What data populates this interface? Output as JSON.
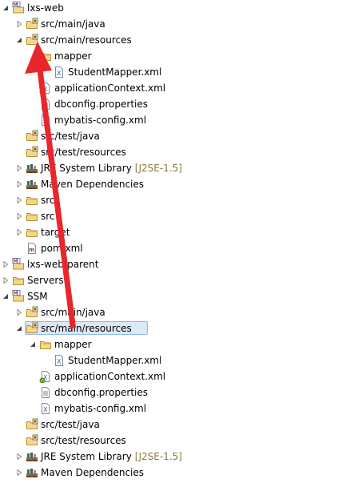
{
  "tree": [
    {
      "label": "lxs-web",
      "level": 0,
      "twisty": "expanded",
      "icon": "maven-project-icon"
    },
    {
      "label": "src/main/java",
      "level": 1,
      "twisty": "collapsed",
      "icon": "source-folder-icon"
    },
    {
      "label": "src/main/resources",
      "level": 1,
      "twisty": "expanded",
      "icon": "source-folder-icon"
    },
    {
      "label": "mapper",
      "level": 2,
      "twisty": "expanded",
      "icon": "folder-icon"
    },
    {
      "label": "StudentMapper.xml",
      "level": 3,
      "twisty": "none",
      "icon": "xml-file-icon"
    },
    {
      "label": "applicationContext.xml",
      "level": 2,
      "twisty": "none",
      "icon": "spring-xml-icon"
    },
    {
      "label": "dbconfig.properties",
      "level": 2,
      "twisty": "none",
      "icon": "properties-file-icon"
    },
    {
      "label": "mybatis-config.xml",
      "level": 2,
      "twisty": "none",
      "icon": "xml-file-icon"
    },
    {
      "label": "src/test/java",
      "level": 1,
      "twisty": "none",
      "icon": "source-folder-icon"
    },
    {
      "label": "src/test/resources",
      "level": 1,
      "twisty": "none",
      "icon": "source-folder-icon"
    },
    {
      "label": "JRE System Library",
      "decoration": "[J2SE-1.5]",
      "level": 1,
      "twisty": "collapsed",
      "icon": "library-icon"
    },
    {
      "label": "Maven Dependencies",
      "level": 1,
      "twisty": "collapsed",
      "icon": "library-icon"
    },
    {
      "label": "src",
      "level": 1,
      "twisty": "collapsed",
      "icon": "folder-icon"
    },
    {
      "label": "src",
      "level": 1,
      "twisty": "collapsed",
      "icon": "folder-icon"
    },
    {
      "label": "target",
      "level": 1,
      "twisty": "collapsed",
      "icon": "folder-icon"
    },
    {
      "label": "pom.xml",
      "level": 1,
      "twisty": "none",
      "icon": "maven-pom-icon"
    },
    {
      "label": "lxs-web-parent",
      "level": 0,
      "twisty": "collapsed",
      "icon": "maven-project-icon"
    },
    {
      "label": "Servers",
      "level": 0,
      "twisty": "collapsed",
      "icon": "folder-icon"
    },
    {
      "label": "SSM",
      "level": 0,
      "twisty": "expanded",
      "icon": "maven-project-icon"
    },
    {
      "label": "src/main/java",
      "level": 1,
      "twisty": "collapsed",
      "icon": "source-folder-icon"
    },
    {
      "label": "src/main/resources",
      "level": 1,
      "twisty": "expanded",
      "icon": "source-folder-icon",
      "selected": true
    },
    {
      "label": "mapper",
      "level": 2,
      "twisty": "expanded",
      "icon": "folder-icon"
    },
    {
      "label": "StudentMapper.xml",
      "level": 3,
      "twisty": "none",
      "icon": "xml-file-icon"
    },
    {
      "label": "applicationContext.xml",
      "level": 2,
      "twisty": "none",
      "icon": "spring-xml-icon"
    },
    {
      "label": "dbconfig.properties",
      "level": 2,
      "twisty": "none",
      "icon": "properties-file-icon"
    },
    {
      "label": "mybatis-config.xml",
      "level": 2,
      "twisty": "none",
      "icon": "xml-file-icon"
    },
    {
      "label": "src/test/java",
      "level": 1,
      "twisty": "none",
      "icon": "source-folder-icon"
    },
    {
      "label": "src/test/resources",
      "level": 1,
      "twisty": "none",
      "icon": "source-folder-icon"
    },
    {
      "label": "JRE System Library",
      "decoration": "[J2SE-1.5]",
      "level": 1,
      "twisty": "collapsed",
      "icon": "library-icon"
    },
    {
      "label": "Maven Dependencies",
      "level": 1,
      "twisty": "collapsed",
      "icon": "library-icon"
    }
  ],
  "colors": {
    "annotation_arrow": "#e8262b",
    "selection_fill": "#dbe8f6",
    "selection_border": "#93b7e3",
    "decoration_text": "#8a7a3a"
  }
}
